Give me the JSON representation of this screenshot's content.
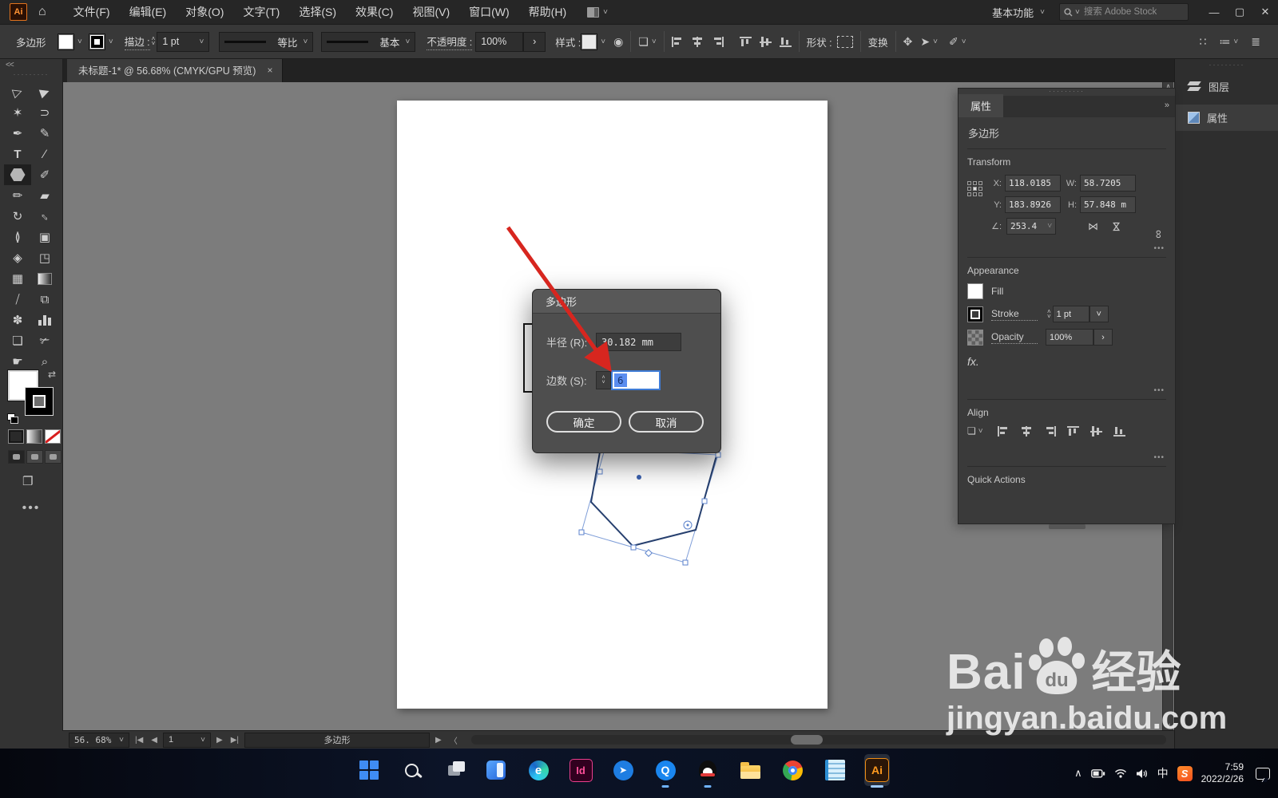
{
  "titlebar": {
    "app_icon": "Ai",
    "menus": [
      "文件(F)",
      "编辑(E)",
      "对象(O)",
      "文字(T)",
      "选择(S)",
      "效果(C)",
      "视图(V)",
      "窗口(W)",
      "帮助(H)"
    ],
    "workspace": "基本功能",
    "search_placeholder": "搜索 Adobe Stock",
    "minimize": "—",
    "maximize": "▢",
    "close": "✕"
  },
  "options_bar": {
    "tool_context": "多边形",
    "stroke_label": "描边 :",
    "stroke_weight": "1 pt",
    "profile": "等比",
    "brush": "基本",
    "opacity_label": "不透明度 :",
    "opacity_value": "100%",
    "style_label": "样式 :",
    "shape_label": "形状 :",
    "transform_label": "变换"
  },
  "document_tab": {
    "title": "未标题-1* @ 56.68% (CMYK/GPU 预览)",
    "close": "×"
  },
  "dialog": {
    "title": "多边形",
    "radius_label": "半径 (R):",
    "radius_value": "30.182 mm",
    "sides_label": "边数 (S):",
    "sides_value": "6",
    "ok": "确定",
    "cancel": "取消"
  },
  "properties_panel": {
    "tab": "属性",
    "object_type": "多边形",
    "transform": {
      "heading": "Transform",
      "x_label": "X:",
      "x": "118.0185",
      "y_label": "Y:",
      "y": "183.8926",
      "w_label": "W:",
      "w": "58.7205",
      "h_label": "H:",
      "h": "57.848 m",
      "angle_label": "∠:",
      "angle": "253.4"
    },
    "appearance": {
      "heading": "Appearance",
      "fill": "Fill",
      "stroke": "Stroke",
      "stroke_weight": "1 pt",
      "opacity": "Opacity",
      "opacity_value": "100%",
      "fx": "fx."
    },
    "align": {
      "heading": "Align"
    },
    "quick_actions": {
      "heading": "Quick Actions"
    }
  },
  "right_dock": {
    "layers": "图层",
    "properties": "属性"
  },
  "status_bar": {
    "zoom": "56. 68%",
    "artboard": "1",
    "tool": "多边形"
  },
  "taskbar": {
    "input_method": "中",
    "time": "7:59",
    "date": "2022/2/26"
  },
  "watermark": {
    "brand_a": "Bai",
    "brand_b": "du",
    "brand_c": "经验",
    "url": "jingyan.baidu.com"
  }
}
